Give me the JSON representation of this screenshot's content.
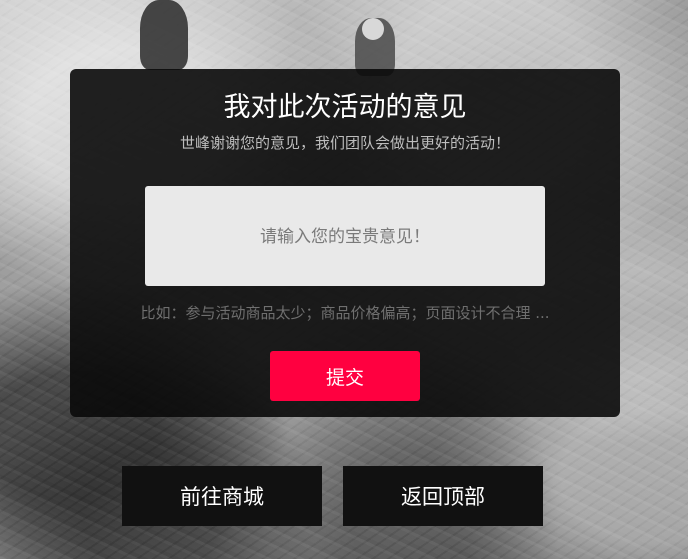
{
  "feedback_panel": {
    "title": "我对此次活动的意见",
    "subtitle": "世峰谢谢您的意见，我们团队会做出更好的活动！",
    "input": {
      "value": "",
      "placeholder": "请输入您的宝贵意见！"
    },
    "hint": "比如：参与活动商品太少；商品价格偏高；页面设计不合理 ...",
    "submit_label": "提交",
    "submit_color": "#ff0040"
  },
  "footer_nav": {
    "mall_label": "前往商城",
    "top_label": "返回顶部"
  }
}
